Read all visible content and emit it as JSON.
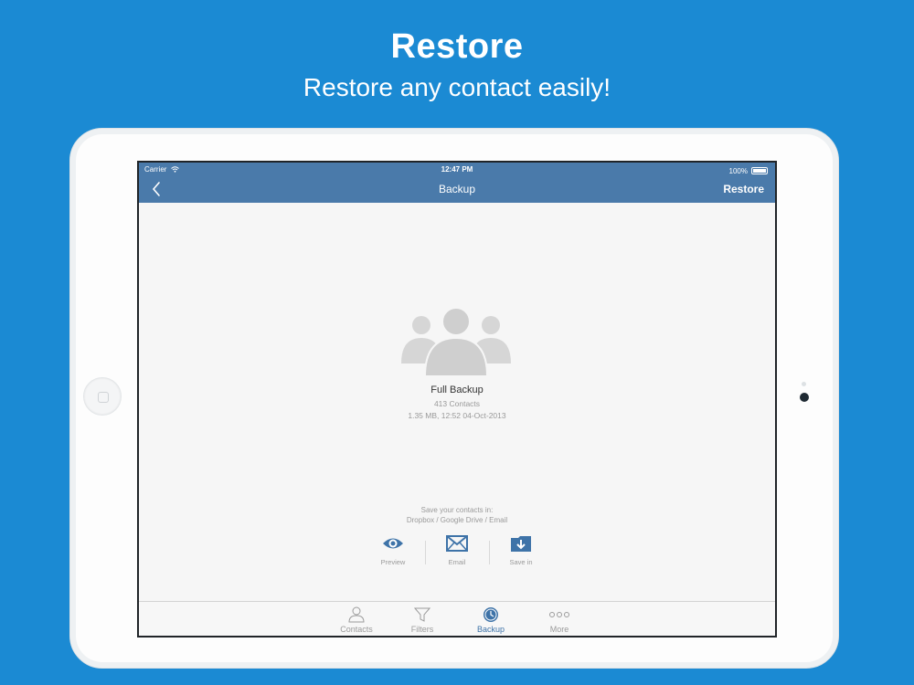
{
  "promo": {
    "headline": "Restore",
    "subheadline": "Restore any contact easily!"
  },
  "status_bar": {
    "carrier": "Carrier",
    "time": "12:47 PM",
    "battery": "100%"
  },
  "nav": {
    "title": "Backup",
    "action_label": "Restore"
  },
  "backup": {
    "title": "Full Backup",
    "count": "413 Contacts",
    "info": "1.35 MB, 12:52 04-Oct-2013"
  },
  "save": {
    "hint_line1": "Save your contacts in:",
    "hint_line2": "Dropbox / Google Drive / Email",
    "actions": [
      {
        "label": "Preview",
        "icon": "eye-icon"
      },
      {
        "label": "Email",
        "icon": "envelope-icon"
      },
      {
        "label": "Save in",
        "icon": "download-folder-icon"
      }
    ]
  },
  "tabs": [
    {
      "label": "Contacts",
      "icon": "person-icon",
      "active": false
    },
    {
      "label": "Filters",
      "icon": "funnel-icon",
      "active": false
    },
    {
      "label": "Backup",
      "icon": "clock-icon",
      "active": true
    },
    {
      "label": "More",
      "icon": "ellipsis-icon",
      "active": false
    }
  ],
  "colors": {
    "background": "#1b8ad3",
    "navbar": "#4a7aaa",
    "accent": "#3e73a8"
  }
}
